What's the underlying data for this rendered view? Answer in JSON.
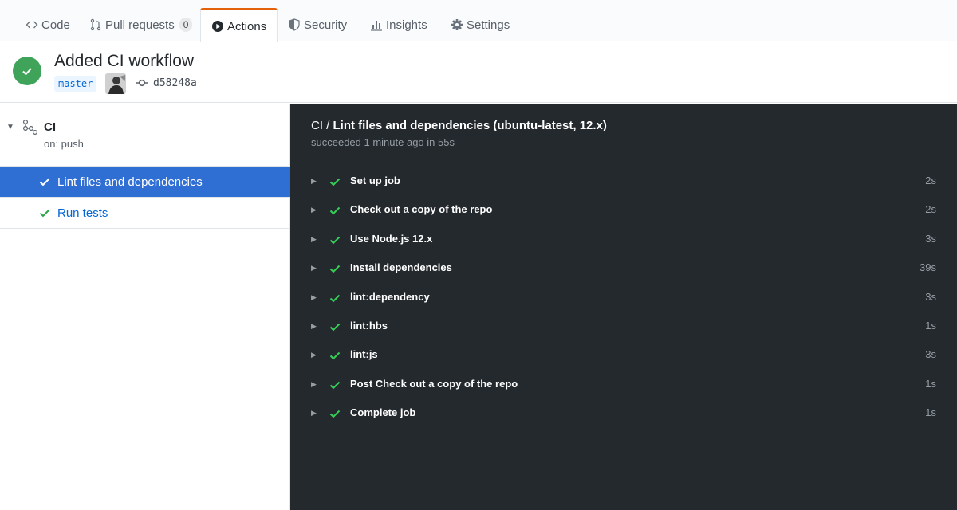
{
  "tabs": [
    {
      "label": "Code",
      "icon": "code-icon"
    },
    {
      "label": "Pull requests",
      "icon": "pull-request-icon",
      "count": "0"
    },
    {
      "label": "Actions",
      "icon": "play-icon",
      "selected": true
    },
    {
      "label": "Security",
      "icon": "shield-icon"
    },
    {
      "label": "Insights",
      "icon": "graph-icon"
    },
    {
      "label": "Settings",
      "icon": "gear-icon"
    }
  ],
  "run": {
    "title": "Added CI workflow",
    "branch": "master",
    "sha": "d58248a",
    "status": "success"
  },
  "workflow": {
    "name": "CI",
    "trigger": "on: push"
  },
  "jobs": [
    {
      "label": "Lint files and dependencies",
      "active": true
    },
    {
      "label": "Run tests",
      "active": false
    }
  ],
  "log": {
    "title_prefix": "CI /",
    "title_job": "Lint files and dependencies (ubuntu-latest, 12.x)",
    "subtitle": "succeeded 1 minute ago in 55s",
    "steps": [
      {
        "name": "Set up job",
        "duration": "2s"
      },
      {
        "name": "Check out a copy of the repo",
        "duration": "2s"
      },
      {
        "name": "Use Node.js 12.x",
        "duration": "3s"
      },
      {
        "name": "Install dependencies",
        "duration": "39s"
      },
      {
        "name": "lint:dependency",
        "duration": "3s"
      },
      {
        "name": "lint:hbs",
        "duration": "1s"
      },
      {
        "name": "lint:js",
        "duration": "3s"
      },
      {
        "name": "Post Check out a copy of the repo",
        "duration": "1s"
      },
      {
        "name": "Complete job",
        "duration": "1s"
      }
    ]
  },
  "colors": {
    "accent_orange": "#e36209",
    "success_green": "#3fa35a",
    "link_blue": "#0366d6",
    "active_job_bg": "#2f6fd4",
    "log_bg": "#24292e"
  }
}
